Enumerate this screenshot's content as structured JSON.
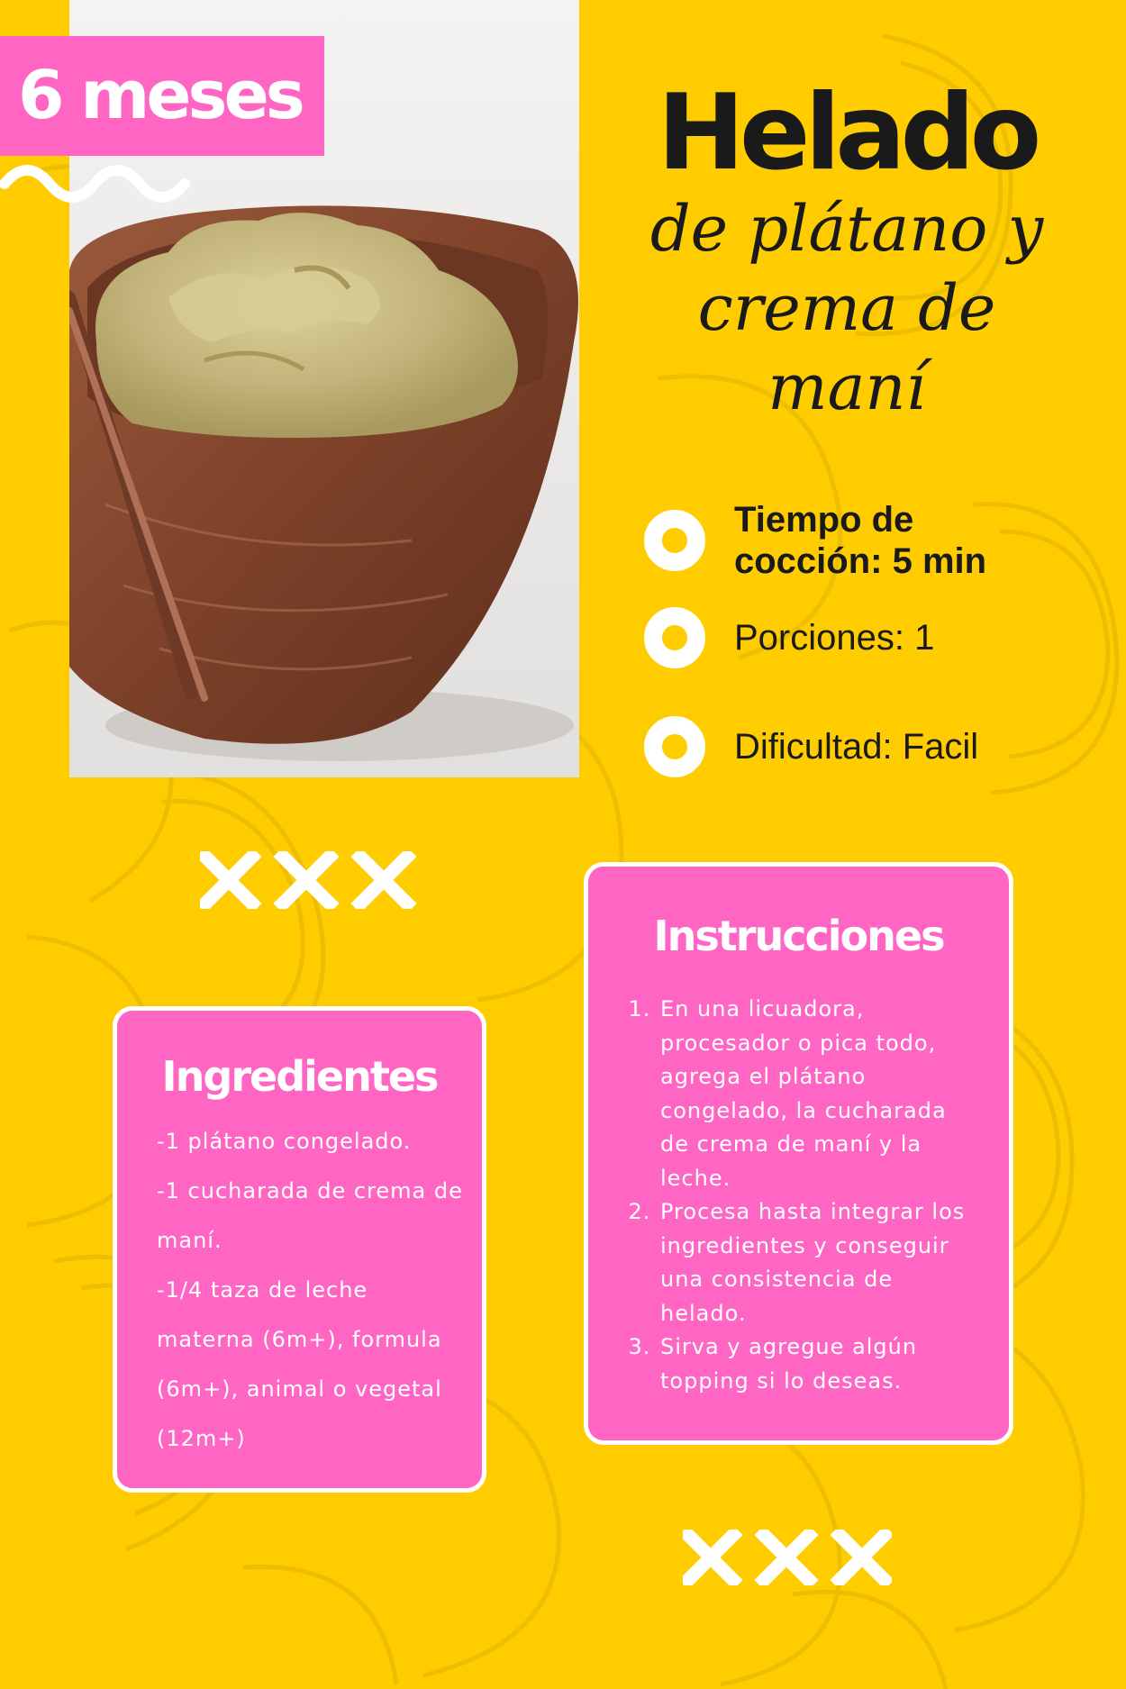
{
  "badge": {
    "age": "6 meses"
  },
  "title": {
    "main": "Helado",
    "script": "de plátano y crema de maní"
  },
  "info": [
    {
      "icon": "ring-bullet-icon",
      "text": "Tiempo de cocción: 5 min"
    },
    {
      "icon": "ring-bullet-icon",
      "text": "Porciones: 1"
    },
    {
      "icon": "ring-bullet-icon",
      "text": "Dificultad: Facil"
    }
  ],
  "ingredients": {
    "title": "Ingredientes",
    "items": [
      "-1 plátano congelado.",
      "-1 cucharada de crema de maní.",
      "-1/4 taza de leche materna (6m+), formula (6m+), animal o vegetal (12m+)"
    ]
  },
  "instructions": {
    "title": "Instrucciones",
    "steps": [
      "En una licuadora, procesador o pica todo, agrega el plátano congelado, la cucharada de crema de maní y la leche.",
      "Procesa hasta integrar los ingredientes y conseguir una consistencia de helado.",
      "Sirva y agregue algún topping si lo deseas."
    ]
  },
  "colors": {
    "background": "#FFCC00",
    "pink": "#FF66C4",
    "text_dark": "#1A1A1A",
    "white": "#FFFFFF"
  }
}
